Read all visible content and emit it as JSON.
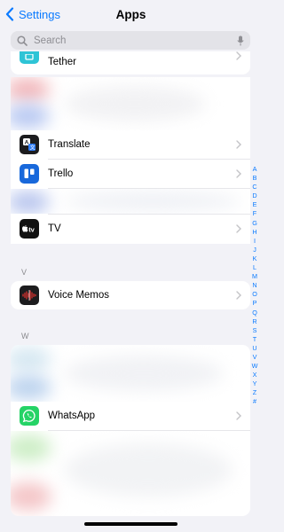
{
  "nav": {
    "back_label": "Settings",
    "title": "Apps"
  },
  "search": {
    "placeholder": "Search"
  },
  "partial_item": {
    "label": "Tether"
  },
  "apps_t": [
    {
      "label": "Translate",
      "icon": "translate-icon"
    },
    {
      "label": "Trello",
      "icon": "trello-icon"
    },
    {
      "label": "TV",
      "icon": "apple-tv-icon"
    }
  ],
  "section_v": {
    "letter": "V",
    "items": [
      {
        "label": "Voice Memos",
        "icon": "voice-memos-icon"
      }
    ]
  },
  "section_w": {
    "letter": "W",
    "items": [
      {
        "label": "WhatsApp",
        "icon": "whatsapp-icon"
      }
    ]
  },
  "index_letters": [
    "A",
    "B",
    "C",
    "D",
    "E",
    "F",
    "G",
    "H",
    "I",
    "J",
    "K",
    "L",
    "M",
    "N",
    "O",
    "P",
    "Q",
    "R",
    "S",
    "T",
    "U",
    "V",
    "W",
    "X",
    "Y",
    "Z",
    "#"
  ],
  "colors": {
    "accent": "#0a7aff",
    "background": "#f2f2f7",
    "trello": "#1868db",
    "whatsapp": "#25d366",
    "voice_memos": "#e0322f"
  }
}
